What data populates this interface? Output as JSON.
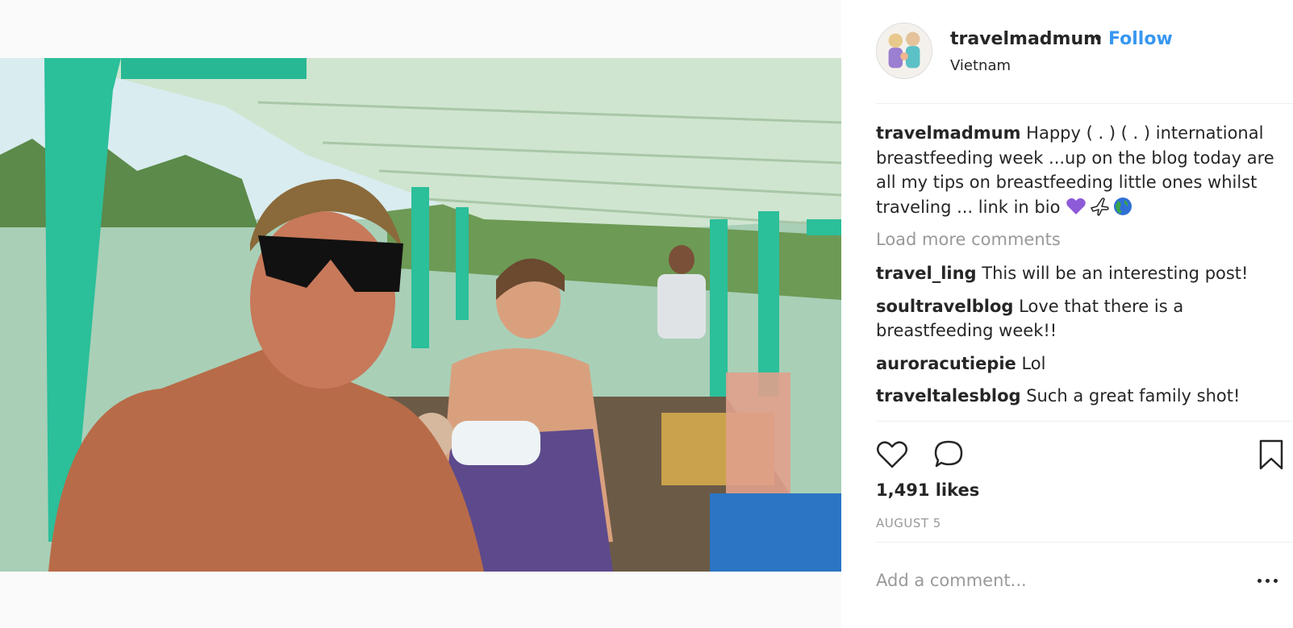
{
  "post": {
    "username": "travelmadmum",
    "separator": "•",
    "follow_label": "Follow",
    "location": "Vietnam",
    "photo_alt": "",
    "caption": {
      "username": "travelmadmum",
      "text": " Happy ( . ) ( . ) international breastfeeding week ...up on the blog today are all my tips on breastfeeding little ones whilst traveling ... link in bio ",
      "emojis": [
        "purple-heart-icon",
        "airplane-icon",
        "globe-icon"
      ]
    },
    "load_more_label": "Load more comments",
    "comments": [
      {
        "username": "travel_ling",
        "text": " This will be an interesting post!"
      },
      {
        "username": "soultravelblog",
        "text": " Love that there is a breastfeeding week!!"
      },
      {
        "username": "auroracutiepie",
        "text": " Lol"
      },
      {
        "username": "traveltalesblog",
        "text": " Such a great family shot!"
      }
    ],
    "likes": "1,491 likes",
    "date": "AUGUST 5",
    "add_comment_placeholder": "Add a comment...",
    "colors": {
      "link": "#3897f0",
      "muted": "#999999",
      "text": "#262626",
      "boat_frame": "#2bbf9a",
      "heart_emoji": "#8e5bd8"
    },
    "icons": {
      "like": "heart-outline-icon",
      "comment": "speech-bubble-icon",
      "save": "bookmark-icon",
      "more": "ellipsis-icon"
    }
  }
}
